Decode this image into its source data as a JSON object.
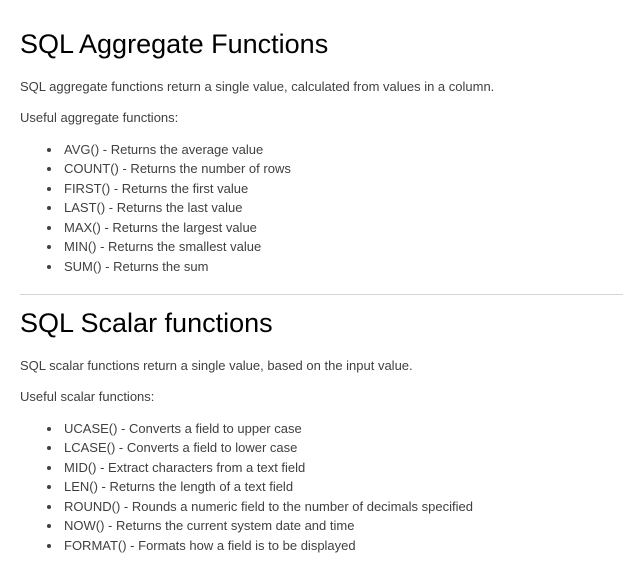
{
  "sections": [
    {
      "heading": "SQL Aggregate Functions",
      "intro": "SQL aggregate functions return a single value, calculated from values in a column.",
      "list_intro": "Useful aggregate functions:",
      "items": [
        "AVG() - Returns the average value",
        "COUNT() - Returns the number of rows",
        "FIRST() - Returns the first value",
        "LAST() - Returns the last value",
        "MAX() - Returns the largest value",
        "MIN() - Returns the smallest value",
        "SUM() - Returns the sum"
      ]
    },
    {
      "heading": "SQL Scalar functions",
      "intro": "SQL scalar functions return a single value, based on the input value.",
      "list_intro": "Useful scalar functions:",
      "items": [
        "UCASE() - Converts a field to upper case",
        "LCASE() - Converts a field to lower case",
        "MID() - Extract characters from a text field",
        "LEN() - Returns the length of a text field",
        "ROUND() - Rounds a numeric field to the number of decimals specified",
        "NOW() - Returns the current system date and time",
        "FORMAT() - Formats how a field is to be displayed"
      ]
    }
  ]
}
